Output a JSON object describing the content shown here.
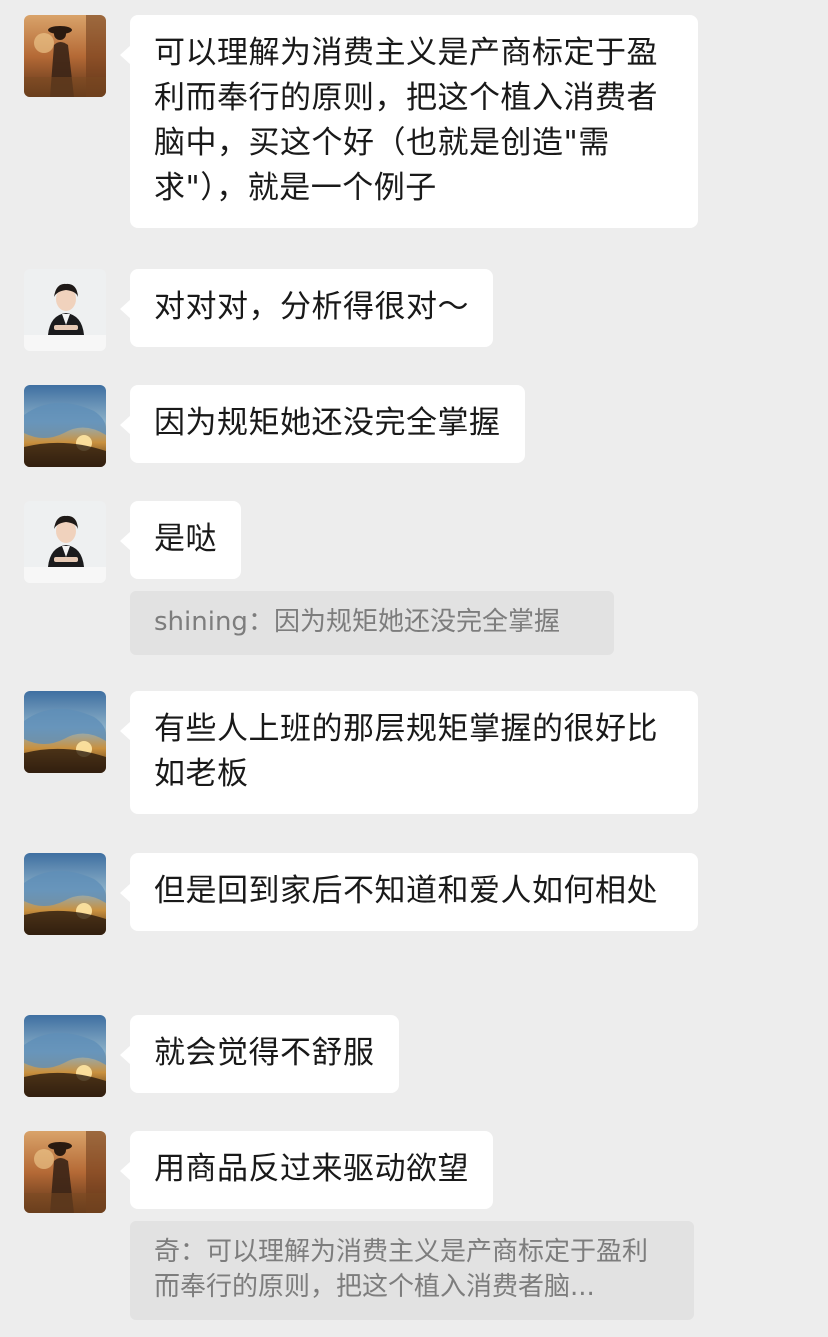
{
  "messages": [
    {
      "avatar": "avatar-sunset-silhouette",
      "text": "可以理解为消费主义是产商标定于盈利而奉行的原则，把这个植入消费者脑中，买这个好（也就是创造\"需求\"），就是一个例子"
    },
    {
      "avatar": "avatar-woman-portrait",
      "text": "对对对，分析得很对～"
    },
    {
      "avatar": "avatar-ocean-wave",
      "text": "因为规矩她还没完全掌握"
    },
    {
      "avatar": "avatar-woman-portrait",
      "text": "是哒",
      "quote": {
        "sender": "shining",
        "text": "因为规矩她还没完全掌握"
      }
    },
    {
      "avatar": "avatar-ocean-wave",
      "text": "有些人上班的那层规矩掌握的很好比如老板"
    },
    {
      "avatar": "avatar-ocean-wave",
      "text": "但是回到家后不知道和爱人如何相处"
    },
    {
      "avatar": "avatar-ocean-wave",
      "text": "就会觉得不舒服"
    },
    {
      "avatar": "avatar-sunset-silhouette",
      "text": "用商品反过来驱动欲望",
      "quote": {
        "sender": "奇",
        "text": "可以理解为消费主义是产商标定于盈利而奉行的原则，把这个植入消费者脑..."
      }
    }
  ],
  "quote_separator": "：",
  "colors": {
    "background": "#ededed",
    "bubble": "#ffffff",
    "quote_background": "#e2e2e2",
    "text": "#191919",
    "quote_text": "#7d7d7d"
  }
}
